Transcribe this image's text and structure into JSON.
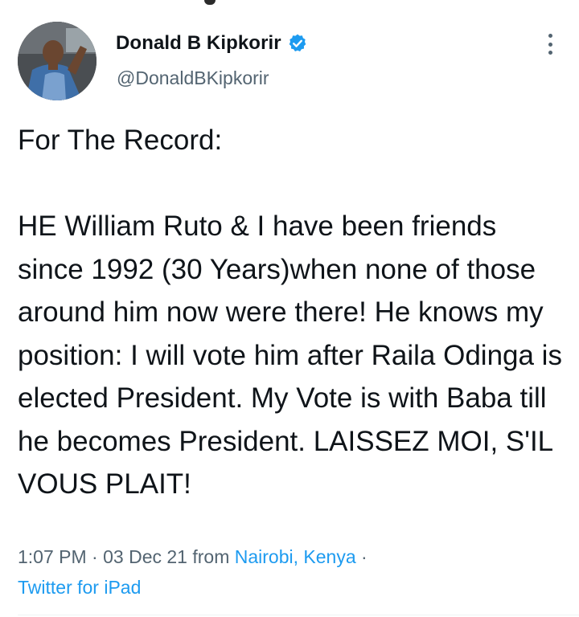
{
  "author": {
    "display_name": "Donald B Kipkorir",
    "handle": "@DonaldBKipkorir",
    "verified_icon": "verified-badge-icon",
    "avatar": "profile-photo"
  },
  "tweet": {
    "text": "For The Record:\n\nHE William Ruto & I have been friends since 1992 (30 Years)when none of those around him now were there! He knows my position: I will vote him after Raila Odinga is elected President. My Vote is with Baba till he becomes President. LAISSEZ MOI, S'IL VOUS PLAIT!",
    "time": "1:07 PM",
    "separator": "·",
    "date": "03 Dec 21",
    "from_label": "from",
    "location": "Nairobi, Kenya",
    "source": "Twitter for iPad"
  },
  "colors": {
    "accent": "#1d9bf0",
    "secondary_text": "#536471",
    "primary_text": "#0f1419"
  },
  "icons": {
    "more": "more-vertical-icon"
  }
}
